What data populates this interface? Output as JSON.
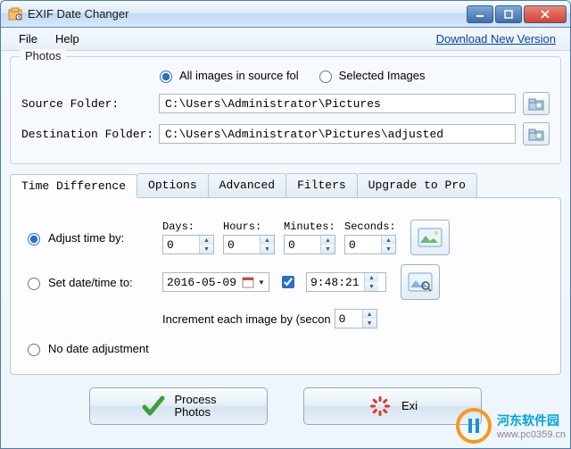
{
  "window": {
    "title": "EXIF Date Changer"
  },
  "menu": {
    "file": "File",
    "help": "Help",
    "download": "Download New Version"
  },
  "photos": {
    "legend": "Photos",
    "radio_all": "All images in source fol",
    "radio_selected": "Selected Images",
    "source_label": "Source Folder:",
    "source_value": "C:\\Users\\Administrator\\Pictures",
    "dest_label": "Destination Folder:",
    "dest_value": "C:\\Users\\Administrator\\Pictures\\adjusted"
  },
  "tabs": {
    "time_diff": "Time Difference",
    "options": "Options",
    "advanced": "Advanced",
    "filters": "Filters",
    "upgrade": "Upgrade to Pro"
  },
  "timediff": {
    "adjust_label": "Adjust time by:",
    "days_h": "Days:",
    "hours_h": "Hours:",
    "minutes_h": "Minutes:",
    "seconds_h": "Seconds:",
    "days_v": "0",
    "hours_v": "0",
    "minutes_v": "0",
    "seconds_v": "0",
    "setdate_label": "Set date/time to:",
    "date_value": "2016-05-09",
    "time_value": "9:48:21",
    "increment_label": "Increment each image by (secon",
    "increment_value": "0",
    "noadjust_label": "No date adjustment"
  },
  "buttons": {
    "process": "Process\nPhotos",
    "exit": "Exi"
  }
}
